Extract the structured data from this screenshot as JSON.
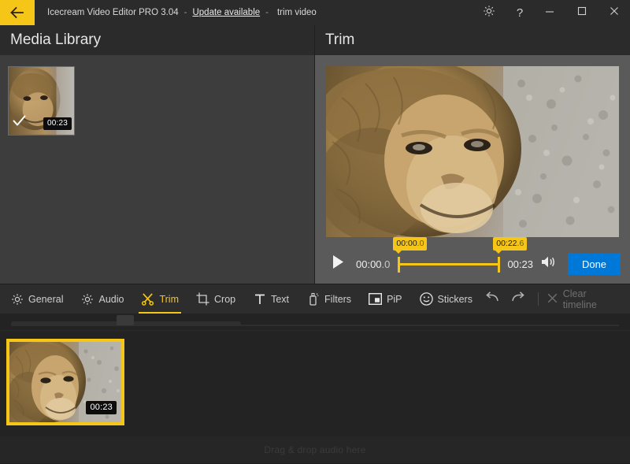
{
  "titlebar": {
    "back_icon": "back-arrow-icon",
    "app_title": "Icecream Video Editor PRO 3.04",
    "sep1": "-",
    "update_link": "Update available",
    "sep2": "-",
    "project_name": "trim video",
    "settings_icon": "gear-icon",
    "help_icon": "question-mark-icon",
    "minimize_icon": "minimize-icon",
    "maximize_icon": "maximize-icon",
    "close_icon": "close-icon"
  },
  "media_library": {
    "title": "Media Library",
    "items": [
      {
        "duration": "00:23",
        "selected": true,
        "check_icon": "checkmark-icon"
      }
    ]
  },
  "trim": {
    "title": "Trim",
    "player": {
      "play_icon": "play-icon",
      "current_time": "00:00",
      "current_time_frac": ".0",
      "total_time": "00:23",
      "volume_icon": "volume-icon",
      "done_label": "Done"
    },
    "range": {
      "start_label": "00:00",
      "start_label_frac": ".0",
      "end_label": "00:22",
      "end_label_frac": ".6",
      "start_pct": 0.0,
      "end_pct": 98.3
    }
  },
  "toolbar": {
    "tabs": [
      {
        "label": "General",
        "icon": "gear-icon",
        "active": false
      },
      {
        "label": "Audio",
        "icon": "gear-icon",
        "active": false
      },
      {
        "label": "Trim",
        "icon": "scissors-icon",
        "active": true
      },
      {
        "label": "Crop",
        "icon": "crop-icon",
        "active": false
      },
      {
        "label": "Text",
        "icon": "text-t-icon",
        "active": false
      },
      {
        "label": "Filters",
        "icon": "spray-can-icon",
        "active": false
      },
      {
        "label": "PiP",
        "icon": "pip-icon",
        "active": false
      },
      {
        "label": "Stickers",
        "icon": "smiley-icon",
        "active": false
      }
    ],
    "undo_icon": "undo-arrow-icon",
    "redo_icon": "redo-arrow-icon",
    "clear_icon": "close-x-icon",
    "clear_label": "Clear timeline"
  },
  "timeline": {
    "clips": [
      {
        "duration": "00:23",
        "selected": true
      }
    ],
    "audio_hint": "Drag & drop audio here"
  },
  "colors": {
    "accent_yellow": "#f5c518",
    "done_blue": "#0078d7",
    "panel_dark": "#2b2b2b",
    "media_bg": "#3d3d3d",
    "trim_bg": "#5a5a5a",
    "timeline_bg": "#232323"
  }
}
